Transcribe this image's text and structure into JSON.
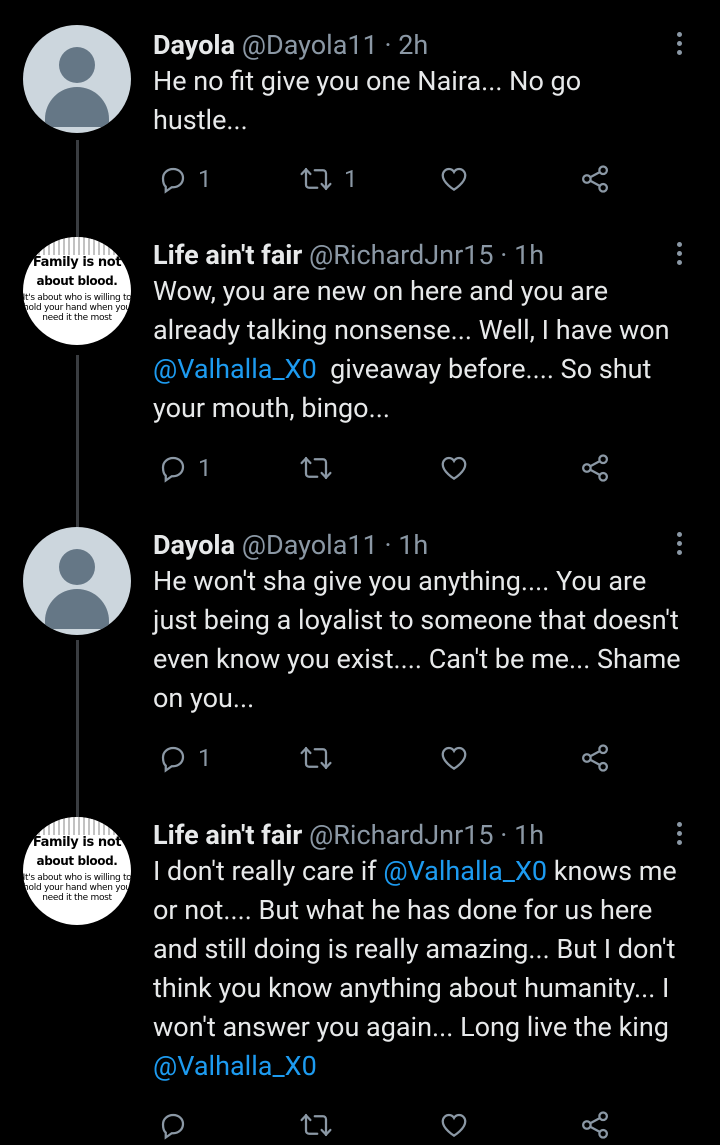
{
  "colors": {
    "background": "#000000",
    "text": "#e7e9ea",
    "secondary_text": "#8b98a5",
    "mention": "#1d9bf0",
    "thread_line": "#3a3d41"
  },
  "tweets": [
    {
      "display_name": "Dayola",
      "handle": "@Dayola11",
      "dot": "·",
      "time": "2h",
      "avatar": "default-avatar-icon",
      "text_parts": [
        {
          "t": "He no fit give you one Naira... No go hustle..."
        }
      ],
      "replies": "1",
      "retweets": "1",
      "likes": ""
    },
    {
      "display_name": "Life ain't fair",
      "handle": "@RichardJnr15",
      "dot": "·",
      "time": "1h",
      "avatar": "quote-avatar",
      "avatar_text": [
        "Family is not",
        "about blood.",
        "It's about who is willing to hold your hand when you need it the most"
      ],
      "text_parts": [
        {
          "t": "Wow, you are new on here and you are already talking nonsense... Well, I have won "
        },
        {
          "t": "@Valhalla_X0",
          "mention": true
        },
        {
          "t": "  giveaway before.... So shut your mouth, bingo..."
        }
      ],
      "replies": "1",
      "retweets": "",
      "likes": ""
    },
    {
      "display_name": "Dayola",
      "handle": "@Dayola11",
      "dot": "·",
      "time": "1h",
      "avatar": "default-avatar-icon",
      "text_parts": [
        {
          "t": "He won't sha give you anything.... You are just being a loyalist to someone that doesn't even know you exist.... Can't be me... Shame on you..."
        }
      ],
      "replies": "1",
      "retweets": "",
      "likes": ""
    },
    {
      "display_name": "Life ain't fair",
      "handle": "@RichardJnr15",
      "dot": "·",
      "time": "1h",
      "avatar": "quote-avatar",
      "avatar_text": [
        "Family is not",
        "about blood.",
        "It's about who is willing to hold your hand when you need it the most"
      ],
      "text_parts": [
        {
          "t": "I don't really care if "
        },
        {
          "t": "@Valhalla_X0",
          "mention": true
        },
        {
          "t": " knows me or not.... But what he has done for us here and still doing is really amazing... But I don't think you know anything about humanity... I won't answer you again... Long live the king "
        },
        {
          "t": "@Valhalla_X0",
          "mention": true
        }
      ],
      "replies": "",
      "retweets": "",
      "likes": ""
    }
  ]
}
